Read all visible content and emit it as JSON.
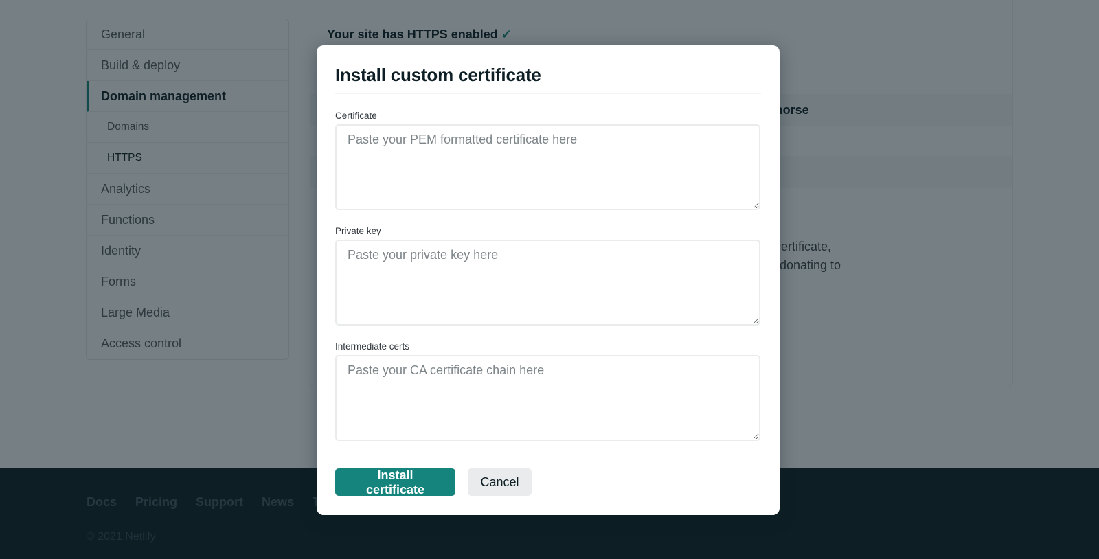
{
  "sidebar": {
    "items": [
      {
        "label": "General",
        "type": "item"
      },
      {
        "label": "Build & deploy",
        "type": "item"
      },
      {
        "label": "Domain management",
        "type": "active"
      },
      {
        "label": "Domains",
        "type": "sub"
      },
      {
        "label": "HTTPS",
        "type": "sub-current"
      },
      {
        "label": "Analytics",
        "type": "item"
      },
      {
        "label": "Functions",
        "type": "item"
      },
      {
        "label": "Identity",
        "type": "item"
      },
      {
        "label": "Forms",
        "type": "item"
      },
      {
        "label": "Large Media",
        "type": "item"
      },
      {
        "label": "Access control",
        "type": "item"
      }
    ]
  },
  "background": {
    "https_status": "Your site has HTTPS enabled",
    "check_glyph": "✓",
    "domain_fragment": "y.horse",
    "text_line1": "certificate,",
    "text_line2": "r donating to"
  },
  "footer": {
    "links": [
      "Docs",
      "Pricing",
      "Support",
      "News",
      "T"
    ],
    "copyright": "© 2021 Netlify"
  },
  "modal": {
    "title": "Install custom certificate",
    "fields": [
      {
        "label": "Certificate",
        "placeholder": "Paste your PEM formatted certificate here",
        "value": ""
      },
      {
        "label": "Private key",
        "placeholder": "Paste your private key here",
        "value": ""
      },
      {
        "label": "Intermediate certs",
        "placeholder": "Paste your CA certificate chain here",
        "value": ""
      }
    ],
    "primary_button": "Install certificate",
    "secondary_button": "Cancel"
  },
  "colors": {
    "accent": "#15847d",
    "dark": "#0e1e25",
    "overlay": "rgba(14,30,37,0.56)"
  }
}
